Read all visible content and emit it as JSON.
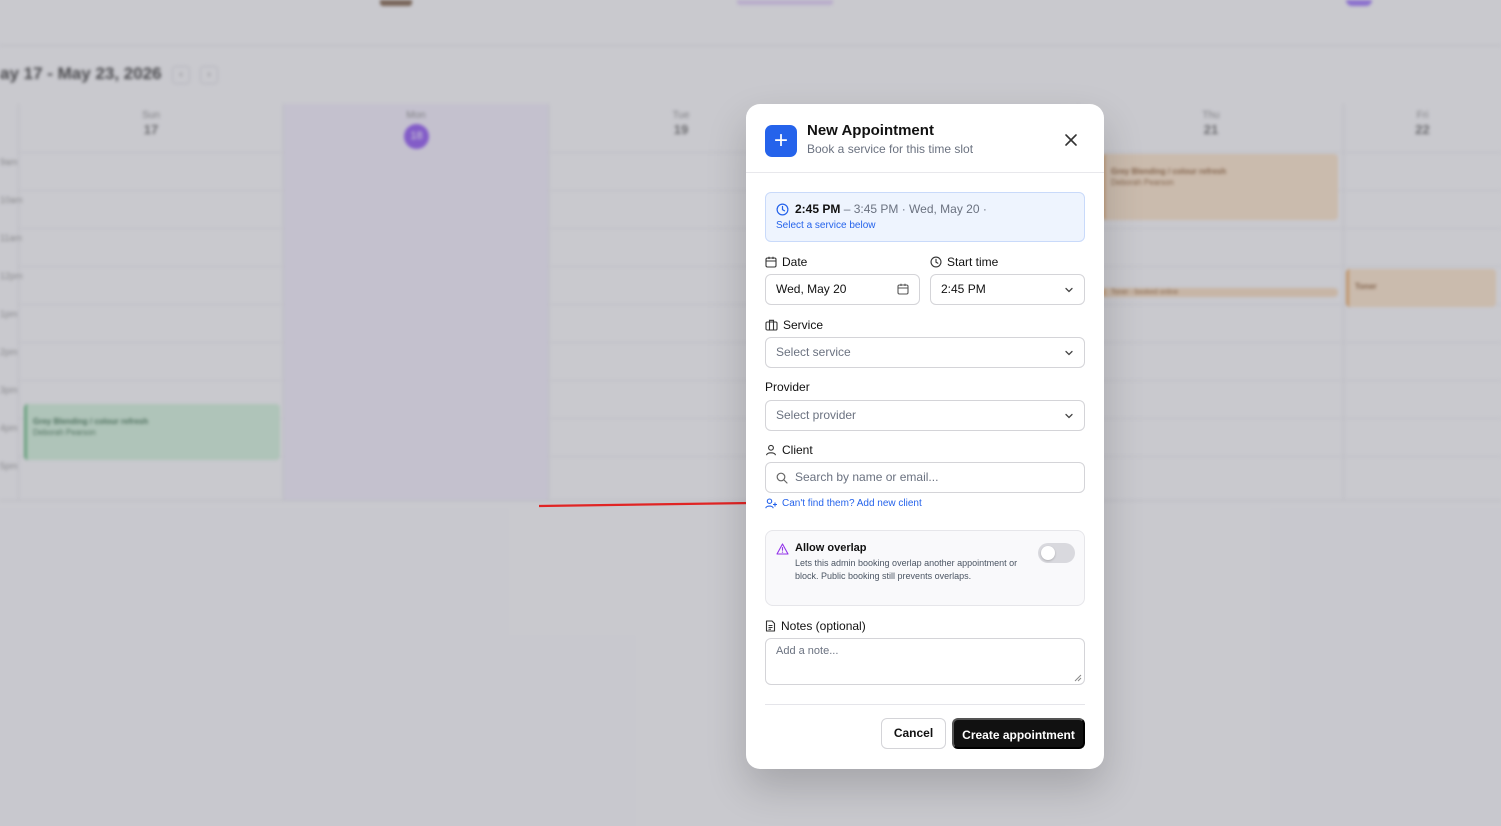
{
  "calendar": {
    "range_label": "ay 17 - May 23, 2026",
    "prev_label": "‹",
    "next_label": "›",
    "days": [
      {
        "name": "Sun",
        "num": "17"
      },
      {
        "name": "Mon",
        "num": "18"
      },
      {
        "name": "Tue",
        "num": "19"
      },
      {
        "name": "Thu",
        "num": "21"
      },
      {
        "name": "Fri",
        "num": "22"
      }
    ],
    "hours": [
      "9am",
      "10am",
      "11am",
      "12pm",
      "1pm",
      "2pm",
      "3pm",
      "4pm",
      "5pm"
    ],
    "events": {
      "sun_title": "Grey Blending / colour refresh",
      "sun_client": "Deborah Pearson",
      "thu_title": "Grey Blending / colour refresh",
      "thu_client": "Deborah Pearson",
      "thu_strip": "Toner - booked online",
      "fri_title": "Toner"
    }
  },
  "modal": {
    "title": "New Appointment",
    "subtitle": "Book a service for this time slot",
    "slot": {
      "start": "2:45 PM",
      "rest": " – 3:45 PM  ·  Wed, May 20  ·",
      "hint": "Select a service below"
    },
    "date": {
      "label": "Date",
      "value": "Wed, May 20"
    },
    "start_time": {
      "label": "Start time",
      "value": "2:45 PM"
    },
    "service": {
      "label": "Service",
      "placeholder": "Select service"
    },
    "provider": {
      "label": "Provider",
      "placeholder": "Select provider"
    },
    "client": {
      "label": "Client",
      "placeholder": "Search by name or email...",
      "add_link": "Can't find them? Add new client"
    },
    "overlap": {
      "title": "Allow overlap",
      "description": "Lets this admin booking overlap another appointment or block. Public booking still prevents overlaps.",
      "enabled": false
    },
    "notes": {
      "label": "Notes (optional)",
      "placeholder": "Add a note..."
    },
    "cancel_label": "Cancel",
    "create_label": "Create appointment"
  },
  "colors": {
    "accent": "#2563eb",
    "primary_button": "#111111",
    "annotation_arrow": "#e02424",
    "warning_icon": "#9333ea"
  }
}
